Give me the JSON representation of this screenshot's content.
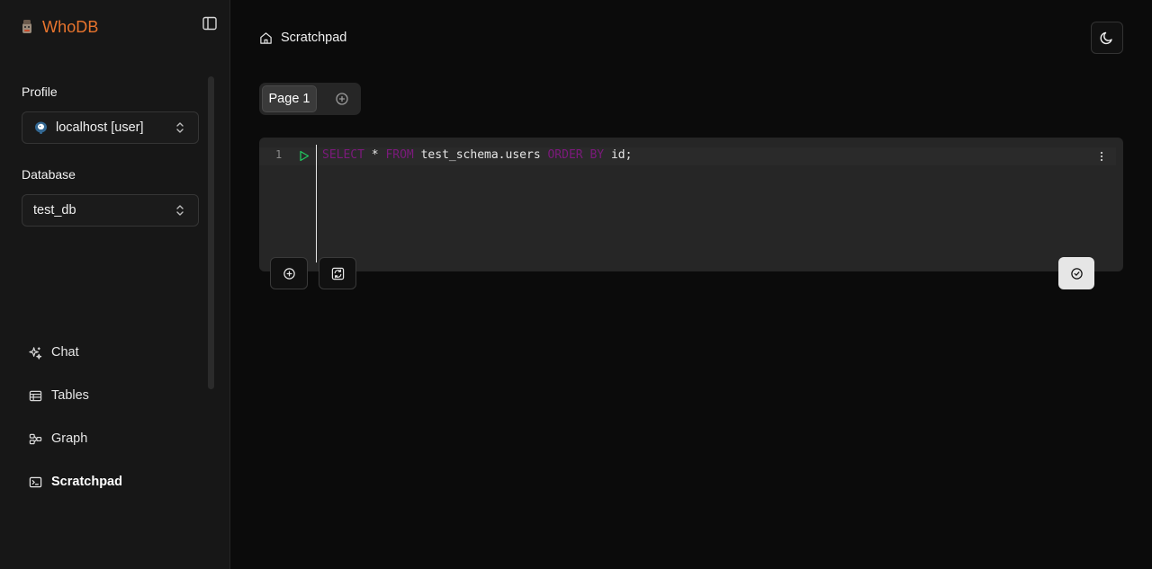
{
  "app": {
    "name": "WhoDB",
    "brand_color": "#e8742d"
  },
  "sidebar": {
    "profile_label": "Profile",
    "profile_value": "localhost [user]",
    "database_label": "Database",
    "database_value": "test_db",
    "nav": [
      {
        "label": "Chat",
        "icon": "sparkles-icon"
      },
      {
        "label": "Tables",
        "icon": "table-icon"
      },
      {
        "label": "Graph",
        "icon": "graph-icon"
      },
      {
        "label": "Scratchpad",
        "icon": "terminal-icon",
        "active": true
      }
    ]
  },
  "header": {
    "breadcrumb": "Scratchpad"
  },
  "tabs": {
    "pages": [
      "Page 1"
    ]
  },
  "editor": {
    "line_number": "1",
    "tokens": {
      "kw1": "SELECT",
      "op": "*",
      "kw2": "FROM",
      "table": "test_schema.users",
      "kw3": "ORDER BY",
      "tail": "id;"
    },
    "keyword_color": "#7c1a7c",
    "run_color": "#22c55e"
  }
}
